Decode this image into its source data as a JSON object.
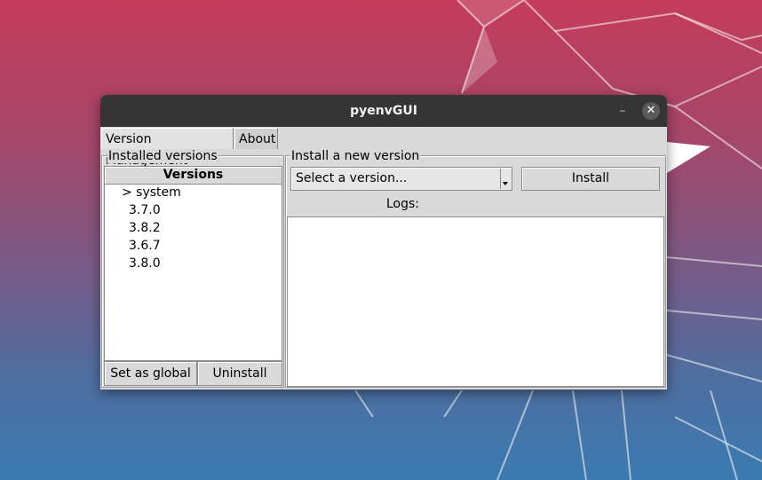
{
  "window": {
    "title": "pyenvGUI",
    "minimize_glyph": "–",
    "close_glyph": "✕"
  },
  "tabs": [
    {
      "label": "Version Management",
      "active": true
    },
    {
      "label": "About",
      "active": false
    }
  ],
  "installed": {
    "group_label": "Installed versions",
    "header": "Versions",
    "items": [
      "> system",
      "3.7.0",
      "3.8.2",
      "3.6.7",
      "3.8.0"
    ],
    "set_global_label": "Set as global",
    "uninstall_label": "Uninstall"
  },
  "install_new": {
    "group_label": "Install a new version",
    "select_value": "Select a version...",
    "install_label": "Install",
    "logs_label": "Logs:"
  },
  "colors": {
    "titlebar": "#353535",
    "window_bg": "#d9d9d9"
  },
  "icons": {
    "minimize": "minimize-icon",
    "close": "close-icon",
    "dropdown": "chevron-down-icon"
  }
}
